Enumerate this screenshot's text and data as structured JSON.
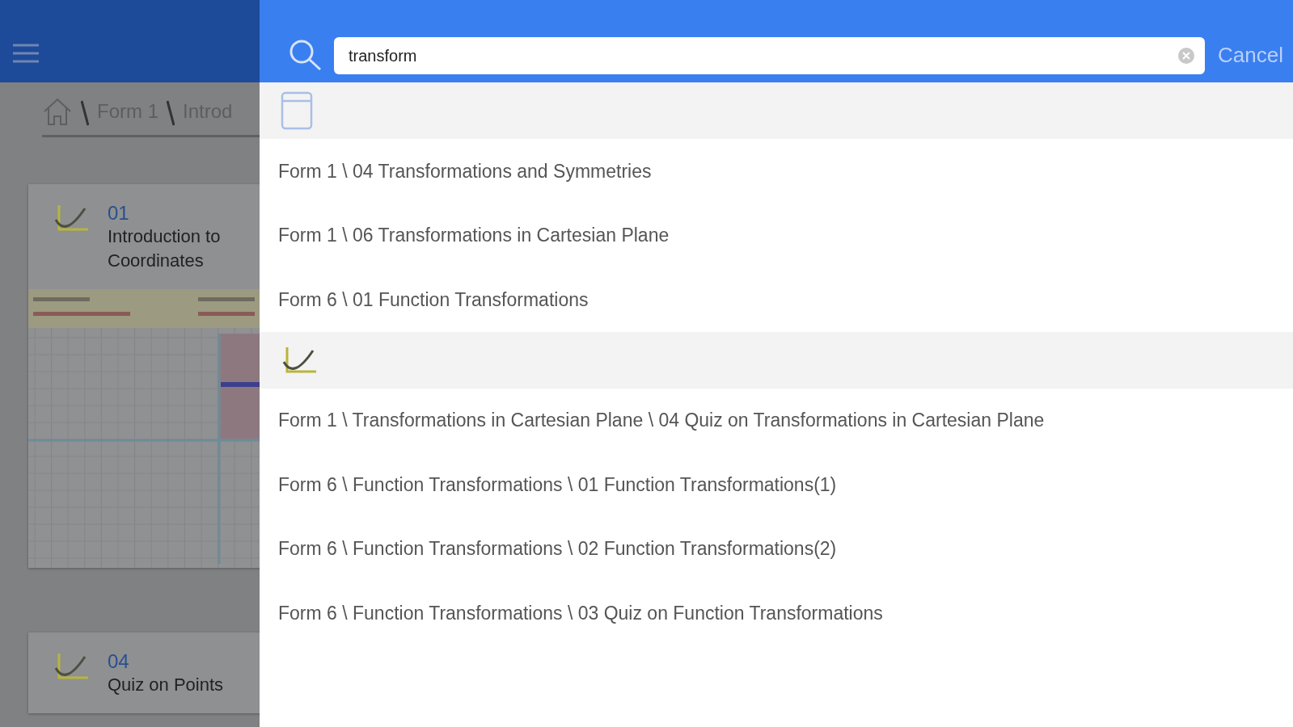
{
  "background_page": {
    "breadcrumb": [
      "Form 1",
      "Introd"
    ],
    "cards": [
      {
        "number": "01",
        "title_lines": [
          "Introduction to",
          "Coordinates"
        ],
        "kind": "graph"
      },
      {
        "number": "04",
        "title_lines": [
          "Quiz on Points"
        ]
      }
    ]
  },
  "search": {
    "query": "transform",
    "cancel": "Cancel"
  },
  "result_groups": [
    {
      "kind": "document",
      "results": [
        "Form 1 \\ 04 Transformations and Symmetries",
        "Form 1 \\ 06 Transformations in Cartesian Plane",
        "Form 6 \\ 01 Function Transformations"
      ]
    },
    {
      "kind": "curve",
      "results": [
        "Form 1 \\ Transformations in Cartesian Plane \\ 04 Quiz on Transformations in Cartesian Plane",
        "Form 6 \\ Function Transformations \\ 01 Function Transformations(1)",
        "Form 6 \\ Function Transformations \\ 02 Function Transformations(2)",
        "Form 6 \\ Function Transformations \\ 03 Quiz on Function Transformations"
      ]
    }
  ]
}
